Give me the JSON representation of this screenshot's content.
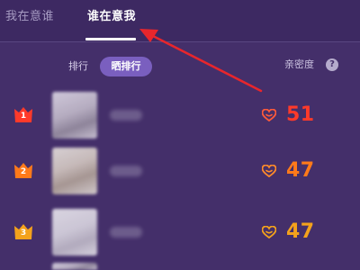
{
  "tabs": {
    "inactive_label": "我在意谁",
    "active_label": "谁在意我"
  },
  "toolbar": {
    "sort_label": "排行",
    "sort_pill_label": "晒排行",
    "closeness_label": "亲密度",
    "help_glyph": "?"
  },
  "rows": [
    {
      "rank": "1",
      "score": "51",
      "crown_color": "#ff3a2a",
      "score_color": "#ff3a2a",
      "heart_color": "#ff5a3a",
      "avatar_icon": "blurred-avatar"
    },
    {
      "rank": "2",
      "score": "47",
      "crown_color": "#ff7a1a",
      "score_color": "#ff7a1a",
      "heart_color": "#ff8a2a",
      "avatar_icon": "blurred-avatar"
    },
    {
      "rank": "3",
      "score": "47",
      "crown_color": "#f4a21c",
      "score_color": "#f4a21c",
      "heart_color": "#f4a21c",
      "avatar_icon": "blurred-avatar"
    }
  ],
  "annotation": {
    "arrow_color": "#e8262c"
  }
}
